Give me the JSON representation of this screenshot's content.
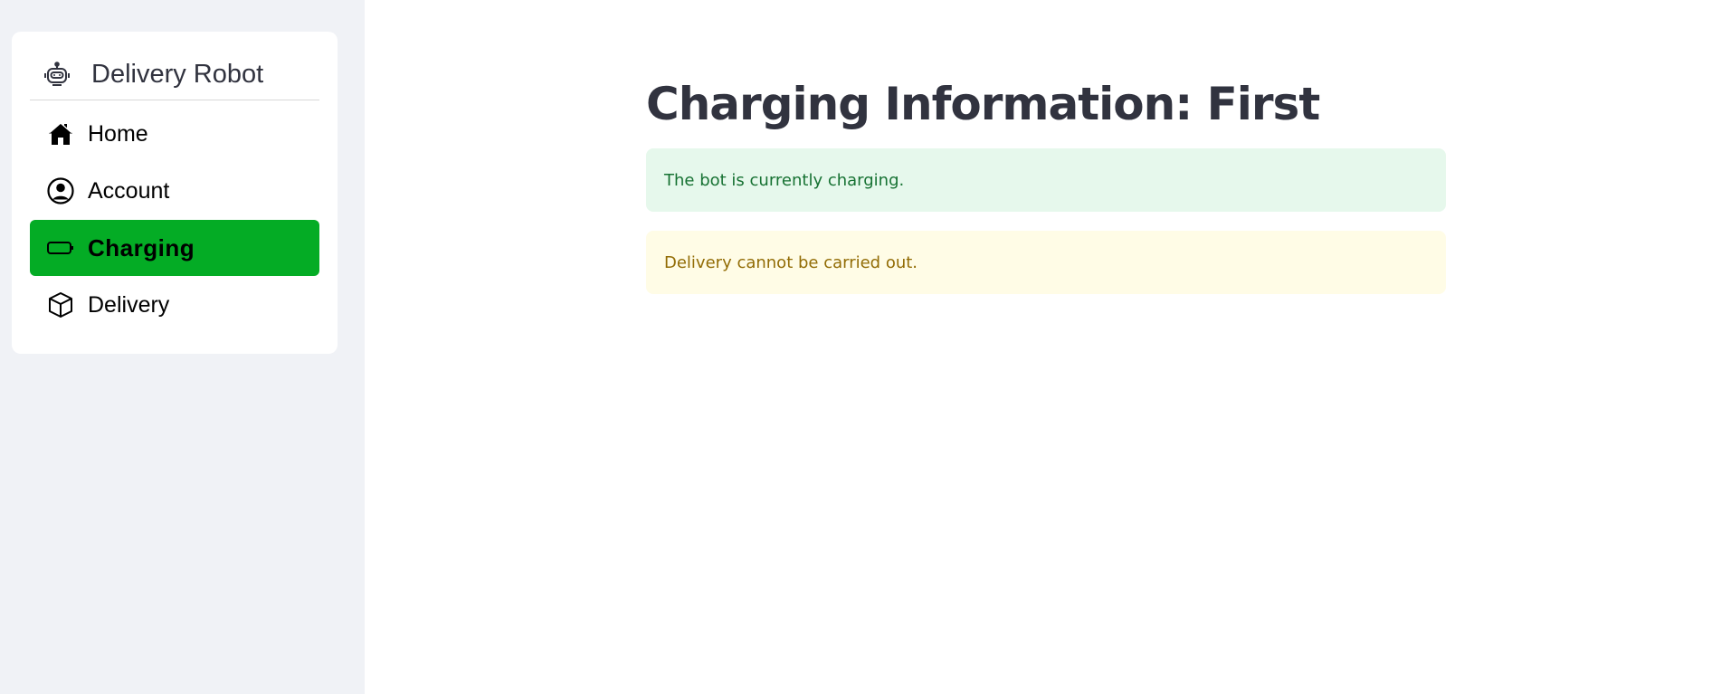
{
  "sidebar": {
    "brand": {
      "title": "Delivery Robot",
      "icon": "robot-icon"
    },
    "items": [
      {
        "label": "Home",
        "icon": "home-icon",
        "active": false
      },
      {
        "label": "Account",
        "icon": "user-circle-icon",
        "active": false
      },
      {
        "label": "Charging",
        "icon": "battery-icon",
        "active": true
      },
      {
        "label": "Delivery",
        "icon": "box-icon",
        "active": false
      }
    ],
    "active_color": "#04ac25"
  },
  "main": {
    "title": "Charging Information: First",
    "alerts": [
      {
        "type": "success",
        "text": "The bot is currently charging."
      },
      {
        "type": "warning",
        "text": "Delivery cannot be carried out."
      }
    ]
  },
  "colors": {
    "sidebar_bg": "#f0f2f6",
    "success_bg": "#e6f8ec",
    "success_text": "#177233",
    "warning_bg": "#fffce6",
    "warning_text": "#926c05",
    "title_text": "#31333f"
  }
}
